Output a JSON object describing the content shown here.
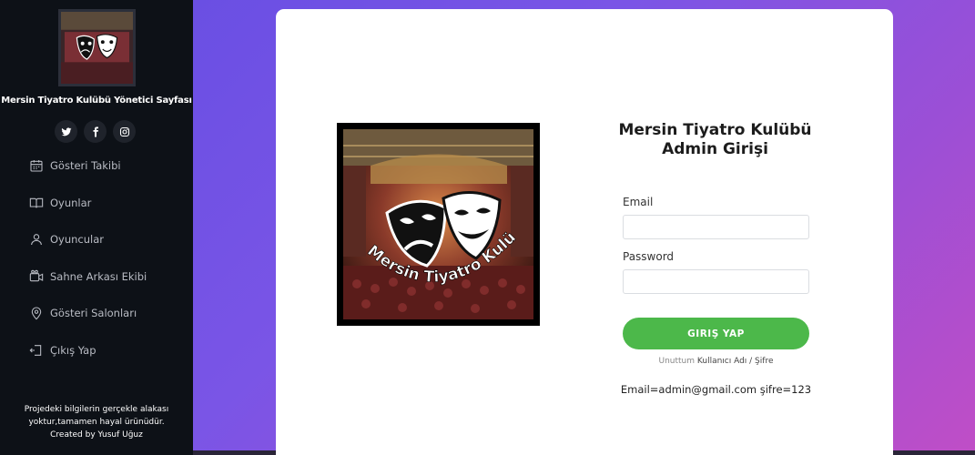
{
  "sidebar": {
    "title": "Mersin Tiyatro Kulübü Yönetici Sayfası",
    "social": [
      {
        "name": "twitter-icon",
        "glyph": "🐦"
      },
      {
        "name": "facebook-icon",
        "glyph": "f"
      },
      {
        "name": "instagram-icon",
        "glyph": "◎"
      }
    ],
    "menu": [
      {
        "label": "Gösteri Takibi",
        "icon": "calendar-icon"
      },
      {
        "label": "Oyunlar",
        "icon": "book-icon"
      },
      {
        "label": "Oyuncular",
        "icon": "user-icon"
      },
      {
        "label": "Sahne Arkası Ekibi",
        "icon": "camera-icon"
      },
      {
        "label": "Gösteri Salonları",
        "icon": "map-pin-icon"
      },
      {
        "label": "Çıkış Yap",
        "icon": "logout-icon"
      }
    ],
    "footer_line1": "Projedeki bilgilerin gerçekle alakası",
    "footer_line2": "yoktur,tamamen hayal ürünüdür.",
    "footer_line3": "Created by Yusuf Uğuz"
  },
  "logo": {
    "text": "Mersin Tiyatro Kulübü"
  },
  "login": {
    "title_line1": "Mersin Tiyatro Kulübü",
    "title_line2": "Admin Girişi",
    "email_label": "Email",
    "email_value": "",
    "password_label": "Password",
    "password_value": "",
    "button_label": "GIRIŞ YAP",
    "forgot_prefix": "Unuttum",
    "forgot_link": "Kullanıcı Adı / Şifre",
    "credentials": "Email=admin@gmail.com şifre=123"
  },
  "colors": {
    "sidebar_bg": "#0d1117",
    "button_green": "#4cb84a",
    "gradient_start": "#6a4fe3",
    "gradient_end": "#c04ec6"
  }
}
